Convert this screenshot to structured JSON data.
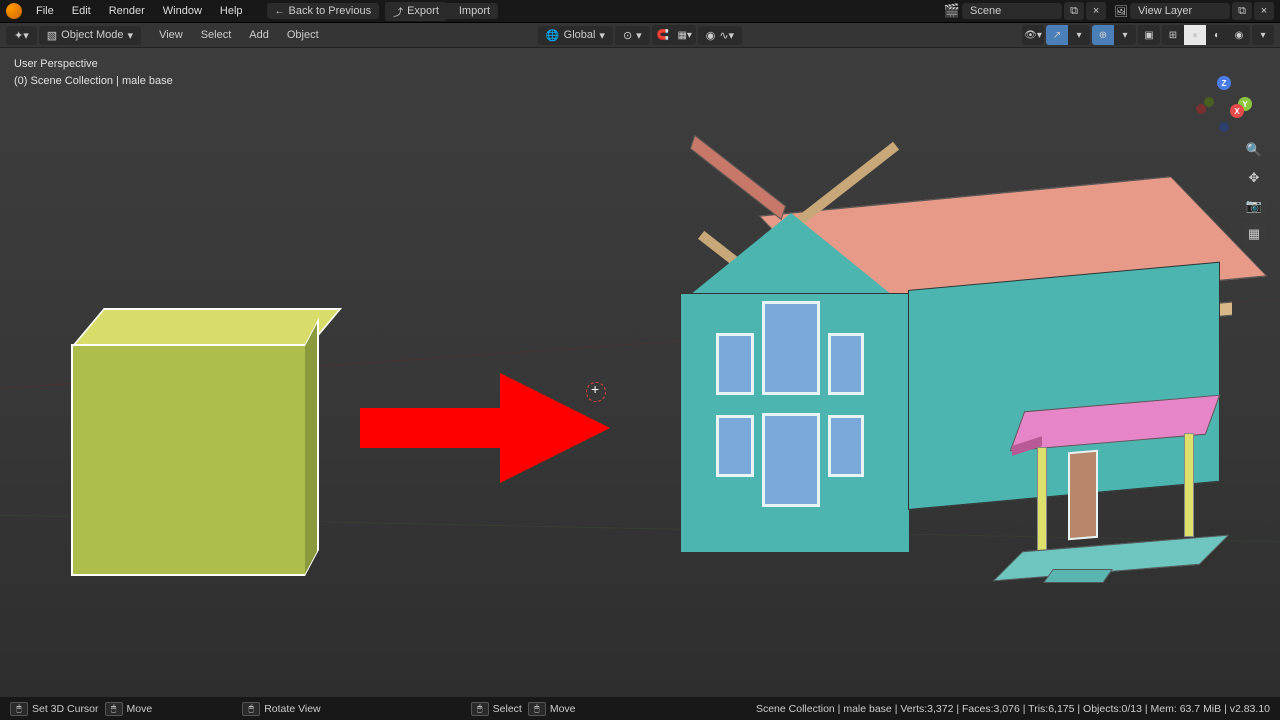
{
  "menus": {
    "file": "File",
    "edit": "Edit",
    "render": "Render",
    "window": "Window",
    "help": "Help"
  },
  "top_buttons": {
    "back": "Back to Previous",
    "export": "Export",
    "import": "Import"
  },
  "scene_field": "Scene",
  "viewlayer_field": "View Layer",
  "toolbar": {
    "mode": "Object Mode",
    "view": "View",
    "select": "Select",
    "add": "Add",
    "object": "Object",
    "orientation": "Global"
  },
  "viewport_info": {
    "line1": "User Perspective",
    "line2": "(0) Scene Collection | male base"
  },
  "axes": {
    "x": "X",
    "y": "Y",
    "z": "Z"
  },
  "statusbar": {
    "l1": "Set 3D Cursor",
    "l2": "Move",
    "l3": "Rotate View",
    "l4": "Select",
    "l5": "Move",
    "stats": "Scene Collection | male base | Verts:3,372 | Faces:3,076 | Tris:6,175 | Objects:0/13 | Mem: 63.7 MiB | v2.83.10"
  }
}
